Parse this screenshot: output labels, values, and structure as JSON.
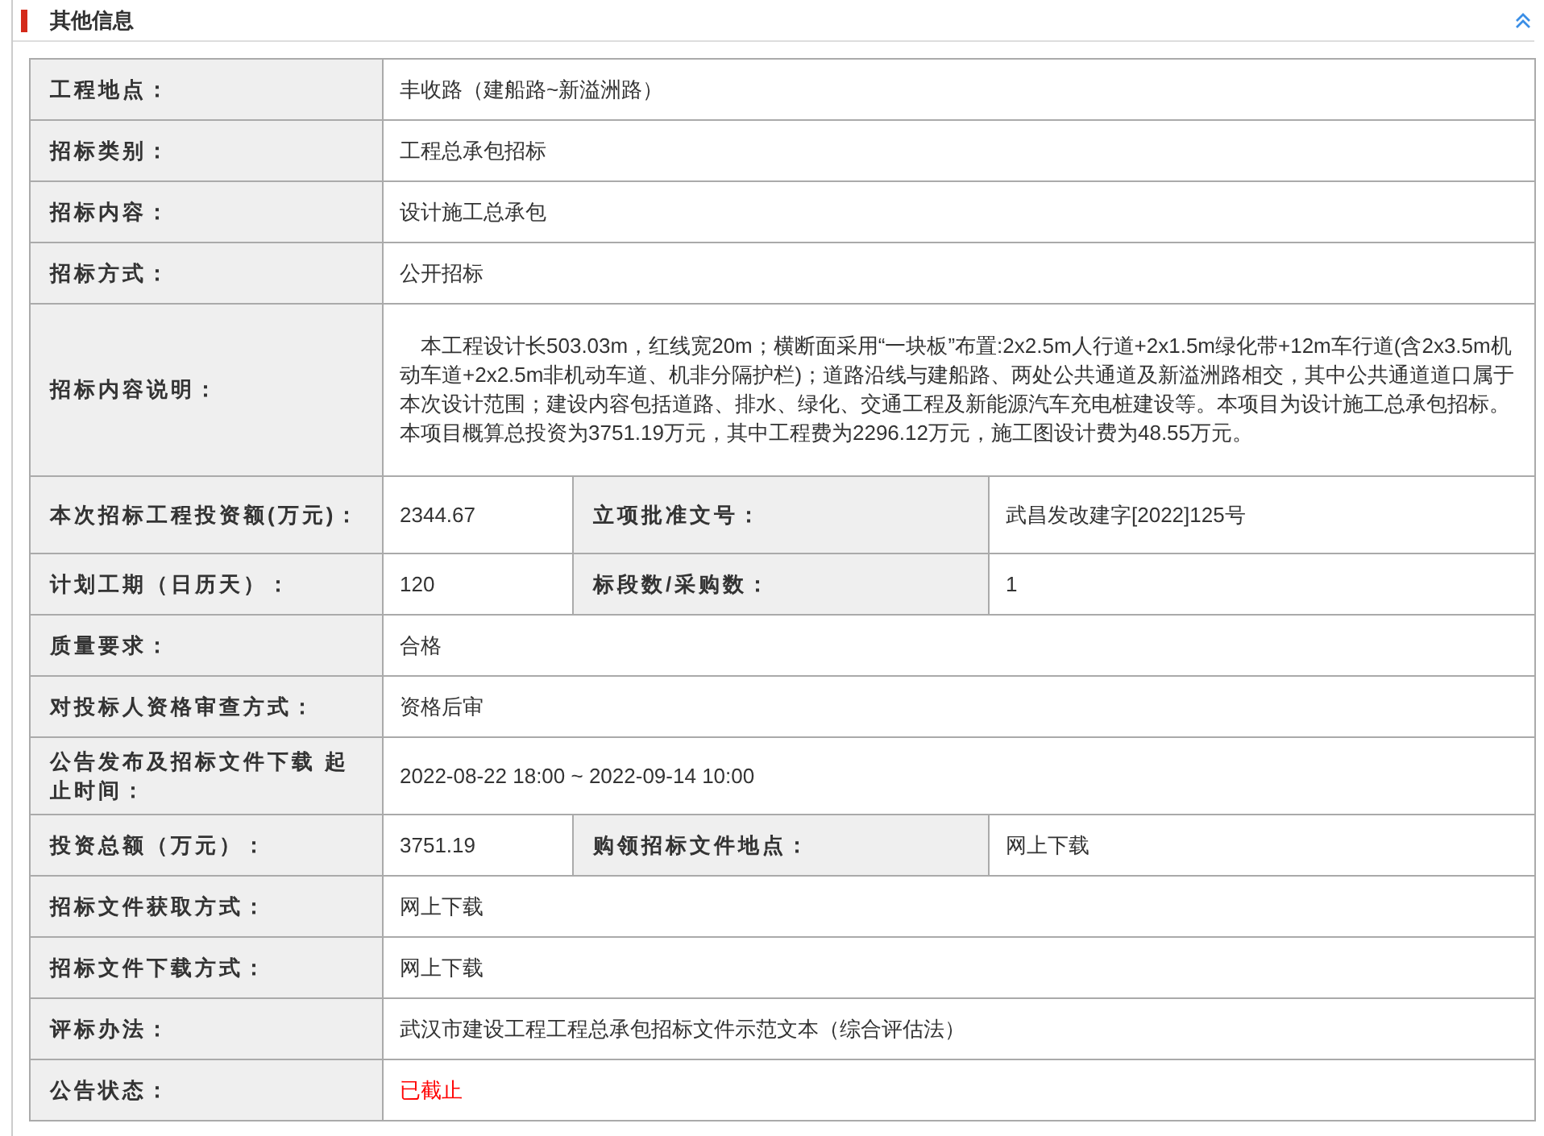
{
  "section": {
    "title": "其他信息"
  },
  "rows": [
    {
      "cells": [
        {
          "label": "工程地点：",
          "value": "丰收路（建船路~新溢洲路）"
        }
      ]
    },
    {
      "cells": [
        {
          "label": "招标类别：",
          "value": "工程总承包招标"
        }
      ]
    },
    {
      "cells": [
        {
          "label": "招标内容：",
          "value": "设计施工总承包"
        }
      ]
    },
    {
      "cells": [
        {
          "label": "招标方式：",
          "value": "公开招标"
        }
      ]
    },
    {
      "cells": [
        {
          "label": "招标内容说明：",
          "value": "本工程设计长503.03m，红线宽20m；横断面采用“一块板”布置:2x2.5m人行道+2x1.5m绿化带+12m车行道(含2x3.5m机动车道+2x2.5m非机动车道、机非分隔护栏)；道路沿线与建船路、两处公共通道及新溢洲路相交，其中公共通道道口属于本次设计范围；建设内容包括道路、排水、绿化、交通工程及新能源汽车充电桩建设等。本项目为设计施工总承包招标。本项目概算总投资为3751.19万元，其中工程费为2296.12万元，施工图设计费为48.55万元。"
        }
      ]
    },
    {
      "cells": [
        {
          "label": "本次招标工程投资额(万元)：",
          "value": "2344.67"
        },
        {
          "label": "立项批准文号：",
          "value": "武昌发改建字[2022]125号"
        }
      ]
    },
    {
      "cells": [
        {
          "label": "计划工期（日历天）：",
          "value": "120"
        },
        {
          "label": "标段数/采购数：",
          "value": "1"
        }
      ]
    },
    {
      "cells": [
        {
          "label": "质量要求：",
          "value": "合格"
        }
      ]
    },
    {
      "cells": [
        {
          "label": "对投标人资格审查方式：",
          "value": "资格后审"
        }
      ]
    },
    {
      "cells": [
        {
          "label": "公告发布及招标文件下载 起止时间：",
          "value": "2022-08-22 18:00 ~ 2022-09-14 10:00"
        }
      ]
    },
    {
      "cells": [
        {
          "label": "投资总额（万元）：",
          "value": "3751.19"
        },
        {
          "label": "购领招标文件地点：",
          "value": "网上下载"
        }
      ]
    },
    {
      "cells": [
        {
          "label": "招标文件获取方式：",
          "value": "网上下载"
        }
      ]
    },
    {
      "cells": [
        {
          "label": "招标文件下载方式：",
          "value": "网上下载"
        }
      ]
    },
    {
      "cells": [
        {
          "label": "评标办法：",
          "value": "武汉市建设工程工程总承包招标文件示范文本（综合评估法）"
        }
      ]
    },
    {
      "cells": [
        {
          "label": "公告状态：",
          "value": "已截止",
          "kind": "status"
        }
      ]
    }
  ]
}
